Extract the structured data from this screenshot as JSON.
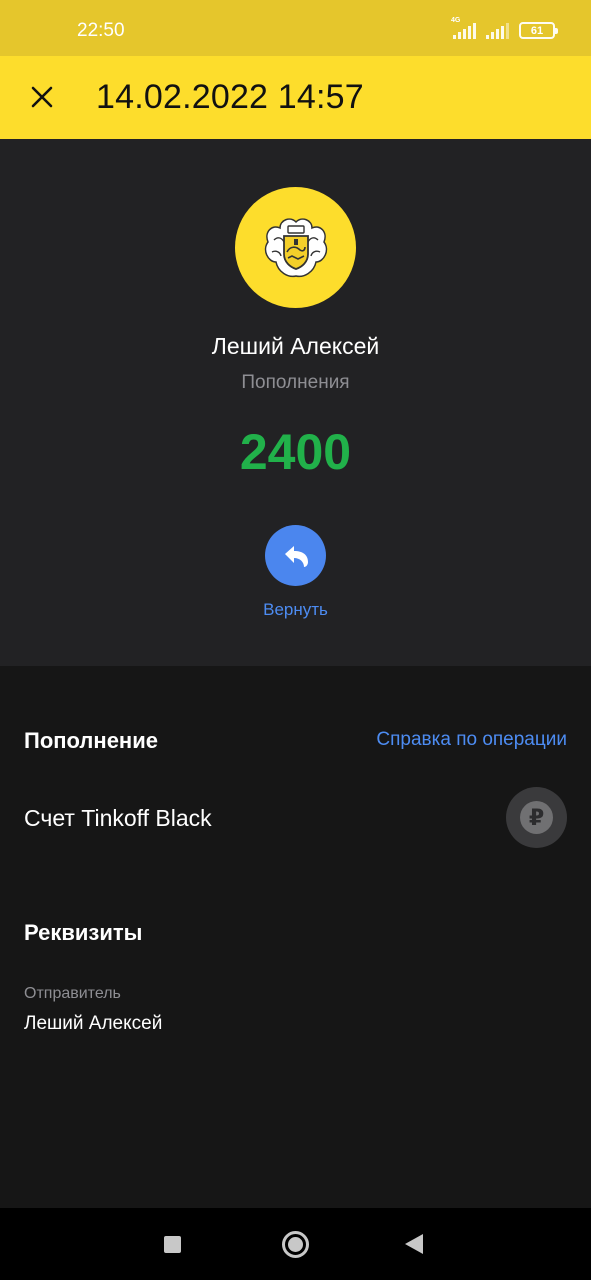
{
  "status_bar": {
    "time": "22:50",
    "network_label": "4G",
    "battery": "61"
  },
  "header": {
    "title": "14.02.2022 14:57"
  },
  "operation": {
    "counterparty": "Леший Алексей",
    "category": "Пополнения",
    "amount": "2400",
    "return_label": "Вернуть"
  },
  "details": {
    "section_title": "Пополнение",
    "help_link": "Справка по операции",
    "account": "Счет Tinkoff Black",
    "currency_symbol": "₽"
  },
  "requisites": {
    "section_title": "Реквизиты",
    "sender_label": "Отправитель",
    "sender_value": "Леший Алексей"
  },
  "colors": {
    "header_yellow": "#fddd2c",
    "amount_green": "#21b14a",
    "accent_blue": "#4d8cf2"
  },
  "icons": [
    "close-icon",
    "bank-logo-icon",
    "return-arrow-icon",
    "ruble-icon",
    "nav-recents-icon",
    "nav-home-icon",
    "nav-back-icon"
  ]
}
